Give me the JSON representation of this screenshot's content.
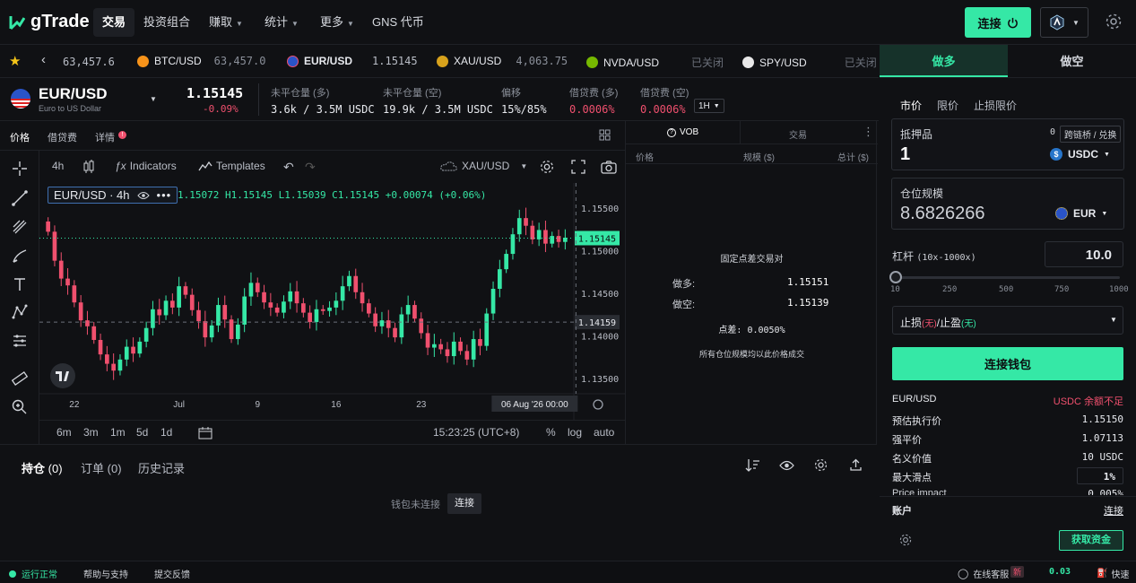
{
  "nav": {
    "brand": "gTrade",
    "items": [
      {
        "label": "交易",
        "active": true,
        "dropdown": false
      },
      {
        "label": "投资组合",
        "active": false,
        "dropdown": false
      },
      {
        "label": "赚取",
        "active": false,
        "dropdown": true
      },
      {
        "label": "统计",
        "active": false,
        "dropdown": true
      },
      {
        "label": "更多",
        "active": false,
        "dropdown": true
      },
      {
        "label": "GNS 代币",
        "active": false,
        "dropdown": false
      }
    ],
    "connect_label": "连接"
  },
  "ticker": {
    "first_price": "63,457.6",
    "items": [
      {
        "symbol": "BTC/USD",
        "price": "63,457.0",
        "icon": "btc-icon",
        "color": "#f7931a"
      },
      {
        "symbol": "EUR/USD",
        "price": "1.15145",
        "icon": "eu-flag-icon",
        "color": "#2a54c8"
      },
      {
        "symbol": "XAU/USD",
        "price": "4,063.75",
        "icon": "gold-icon",
        "color": "#d8a21c"
      },
      {
        "symbol": "NVDA/USD",
        "price": "已关闭",
        "icon": "nvda-icon",
        "color": "#76b900"
      },
      {
        "symbol": "SPY/USD",
        "price": "已关闭",
        "icon": "spy-icon",
        "color": "#e8e8e8"
      }
    ]
  },
  "side_tabs": {
    "long": "做多",
    "short": "做空"
  },
  "pair": {
    "symbol": "EUR/USD",
    "name": "Euro to US Dollar",
    "price": "1.15145",
    "change": "-0.09%",
    "stats": [
      {
        "label": "未平仓量 (多)",
        "value": "3.6k / 3.5M USDC",
        "color": "#e7e9ee"
      },
      {
        "label": "未平仓量 (空)",
        "value": "19.9k / 3.5M USDC",
        "color": "#e7e9ee"
      },
      {
        "label": "偏移",
        "value": "15%/85%",
        "color": "#e7e9ee"
      },
      {
        "label": "借贷费 (多)",
        "value": "0.0006%",
        "color": "#f0506e"
      },
      {
        "label": "借贷费 (空)",
        "value": "0.0006%",
        "color": "#f0506e"
      }
    ],
    "interval": "1H"
  },
  "chart_tabs": [
    "价格",
    "借贷费",
    "详情"
  ],
  "chart_toolbar": {
    "interval": "4h",
    "indicators": "Indicators",
    "templates": "Templates",
    "compare_symbol": "XAU/USD"
  },
  "chart_legend": {
    "symbol": "EUR/USD · 4h",
    "ohlc": "1.15072 H1.15145 L1.15039 C1.15145 +0.00074 (+0.06%)"
  },
  "chart_data": {
    "type": "candlestick",
    "title": "EUR/USD · 4h",
    "ylim": [
      1.1335,
      1.1575
    ],
    "y_ticks": [
      "1.15500",
      "1.15000",
      "1.14500",
      "1.14000",
      "1.13500"
    ],
    "y_tick_values": [
      1.155,
      1.15,
      1.145,
      1.14,
      1.135
    ],
    "x_ticks": [
      "22",
      "Jul",
      "9",
      "16",
      "23"
    ],
    "x_tick_index": [
      4,
      20,
      32,
      44,
      57
    ],
    "current_price": "1.15145",
    "current_price_value": 1.15145,
    "marker_price": "1.14159",
    "marker_price_value": 1.14159,
    "crosshair_label": "06 Aug '26   00:00",
    "closes": [
      1.1522,
      1.1488,
      1.1467,
      1.1459,
      1.1439,
      1.1418,
      1.1411,
      1.1395,
      1.1378,
      1.1367,
      1.1359,
      1.1372,
      1.1387,
      1.1379,
      1.1393,
      1.1409,
      1.1431,
      1.1424,
      1.1441,
      1.1433,
      1.1458,
      1.1448,
      1.143,
      1.1417,
      1.1398,
      1.1412,
      1.1436,
      1.1419,
      1.1396,
      1.1413,
      1.1446,
      1.1462,
      1.1451,
      1.1439,
      1.1433,
      1.1427,
      1.144,
      1.1452,
      1.1438,
      1.1427,
      1.1416,
      1.1431,
      1.1429,
      1.1433,
      1.1441,
      1.1458,
      1.147,
      1.1451,
      1.1438,
      1.1426,
      1.1411,
      1.1418,
      1.1409,
      1.1398,
      1.1425,
      1.1436,
      1.142,
      1.1403,
      1.1386,
      1.139,
      1.1384,
      1.1376,
      1.1393,
      1.1382,
      1.1372,
      1.1396,
      1.1388,
      1.1426,
      1.1455,
      1.1478,
      1.1496,
      1.1519,
      1.1538,
      1.1529,
      1.1513,
      1.1524,
      1.1508,
      1.1517,
      1.151,
      1.1515
    ],
    "timeframes": [
      "6m",
      "3m",
      "1m",
      "5d",
      "1d"
    ],
    "time_label": "15:23:25 (UTC+8)",
    "scale_opts": [
      "%",
      "log",
      "auto"
    ]
  },
  "orderbook": {
    "tab_vob": "VOB",
    "tab_trades": "交易",
    "headers": [
      "价格",
      "规模 ($)",
      "总计 ($)"
    ],
    "title": "固定点差交易对",
    "long_label": "做多:",
    "long_price": "1.15151",
    "short_label": "做空:",
    "short_price": "1.15139",
    "spread": "点差: 0.0050%",
    "note": "所有仓位规模均以此价格成交"
  },
  "positions": {
    "tabs": [
      {
        "label": "持仓",
        "count": "(0)",
        "active": true
      },
      {
        "label": "订单",
        "count": "(0)",
        "active": false
      },
      {
        "label": "历史记录",
        "count": "",
        "active": false
      }
    ],
    "empty": "钱包未连接",
    "connect": "连接"
  },
  "panel": {
    "order_types": [
      "市价",
      "限价",
      "止损限价"
    ],
    "collateral_label": "抵押品",
    "collateral_balance": "0",
    "bridge_label": "跨链桥 / 兑换",
    "collateral_value": "1",
    "collateral_token": "USDC",
    "size_label": "仓位规模",
    "size_value": "8.6826266",
    "size_token": "EUR",
    "leverage_label": "杠杆",
    "leverage_range": "(10x-1000x)",
    "leverage_value": "10.0",
    "leverage_fraction": 0,
    "slider_ticks": [
      "10",
      "250",
      "500",
      "750",
      "1000"
    ],
    "sltp_prefix": "止损",
    "sltp_none": "(无)",
    "sltp_mid": "/止盈",
    "connect_wallet": "连接钱包",
    "info": [
      {
        "k": "EUR/USD",
        "v": "USDC  余额不足",
        "vcolor": "#f0506e"
      },
      {
        "k": "预估执行价",
        "v": "1.15150",
        "vcolor": "#e7e9ee"
      },
      {
        "k": "强平价",
        "v": "1.07113",
        "vcolor": "#e7e9ee"
      },
      {
        "k": "名义价值",
        "v": "10 USDC",
        "vcolor": "#e7e9ee"
      }
    ],
    "slippage_label": "最大滑点",
    "slippage_value": "1%",
    "price_impact_label": "Price impact",
    "price_impact_value": "0.005%",
    "account_label": "账户",
    "account_link": "连接",
    "get_funds": "获取资金"
  },
  "status": {
    "ok": "运行正常",
    "help": "帮助与支持",
    "feedback": "提交反馈",
    "chat": "在线客服",
    "new_badge": "新",
    "gas": "0.03",
    "fast": "快速"
  },
  "colors": {
    "accent": "#35e8a6",
    "down": "#f0506e",
    "bg": "#101114"
  }
}
